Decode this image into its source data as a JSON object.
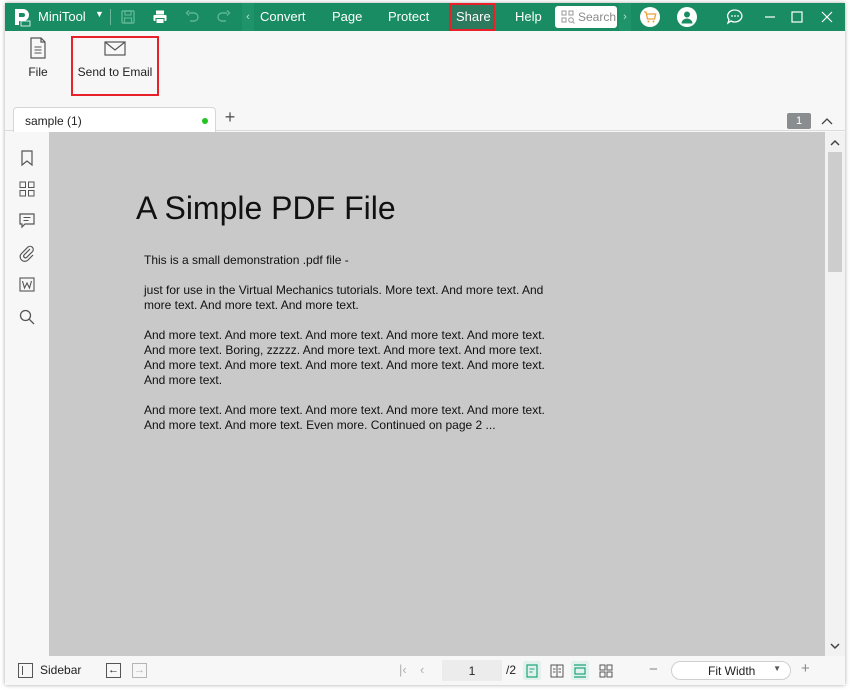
{
  "app": {
    "name": "MiniTool",
    "brand_color": "#198c64",
    "highlight_color": "#e8202a"
  },
  "titlebar": {
    "menu": [
      "Convert",
      "Page",
      "Protect",
      "Share",
      "Help"
    ],
    "active_menu": "Share",
    "search_placeholder": "Search",
    "icons": [
      "save-icon",
      "print-icon",
      "undo-icon",
      "redo-icon",
      "cart-icon",
      "account-icon",
      "feedback-icon",
      "minimize-icon",
      "maximize-icon",
      "close-icon"
    ]
  },
  "ribbon": {
    "buttons": [
      {
        "label": "File",
        "icon": "file-icon"
      },
      {
        "label": "Send to Email",
        "icon": "mail-icon"
      }
    ]
  },
  "tabs": {
    "items": [
      {
        "label": "sample (1)",
        "unsaved_dot": true
      }
    ],
    "add_label": "+",
    "page_badge": "1"
  },
  "sidebar": {
    "icons": [
      "bookmark-icon",
      "thumbnails-icon",
      "comment-icon",
      "attachment-icon",
      "word-icon",
      "search-icon"
    ]
  },
  "document": {
    "title": "A Simple PDF File",
    "paragraphs": [
      "This is a small demonstration .pdf file -",
      "just for use in the Virtual Mechanics tutorials. More text. And more text. And more text. And more text. And more text.",
      "And more text. And more text. And more text. And more text. And more text. And more text. Boring, zzzzz. And more text. And more text. And more text. And more text. And more text. And more text. And more text. And more text. And more text.",
      "And more text. And more text. And more text. And more text. And more text. And more text. And more text. Even more. Continued on page 2 ..."
    ]
  },
  "statusbar": {
    "sidebar_label": "Sidebar",
    "current_page": "1",
    "total_pages": "/2",
    "zoom": "Fit Width"
  }
}
